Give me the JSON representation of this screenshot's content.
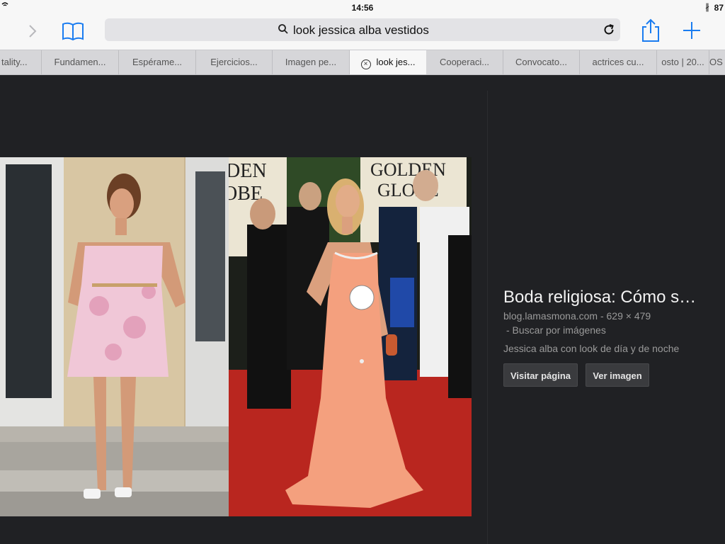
{
  "status": {
    "time": "14:56",
    "battery": "87"
  },
  "browser": {
    "url_text": "look jessica alba vestidos",
    "tabs": [
      {
        "label": "tality..."
      },
      {
        "label": "Fundamen..."
      },
      {
        "label": "Espérame..."
      },
      {
        "label": "Ejercicios..."
      },
      {
        "label": "Imagen pe..."
      },
      {
        "label": "look jes...",
        "active": true
      },
      {
        "label": "Cooperaci..."
      },
      {
        "label": "Convocato..."
      },
      {
        "label": "actrices cu..."
      },
      {
        "label": "osto | 20..."
      },
      {
        "label": "OS D"
      }
    ]
  },
  "result": {
    "title": "Boda religiosa: Cómo s…",
    "source": "blog.lamasmona.com - 629 × 479",
    "search_images": "- Buscar por imágenes",
    "description": "Jessica alba con look de día y de noche",
    "visit_button": "Visitar página",
    "view_button": "Ver imagen"
  },
  "photo_overlay": {
    "left_banner": "DEN\nOBE",
    "right_banner": "GOLDEN\nGLOBE"
  }
}
